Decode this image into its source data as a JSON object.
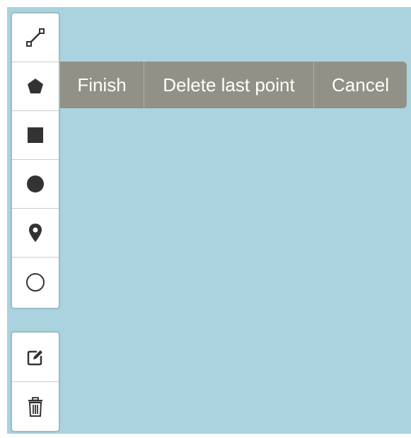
{
  "colors": {
    "map_background": "#aad3df",
    "toolbar_background": "#ffffff",
    "action_bar_background": "#919187",
    "icon_color": "#333333"
  },
  "draw_toolbar": {
    "tools": [
      {
        "name": "polyline",
        "icon": "polyline-icon"
      },
      {
        "name": "polygon",
        "icon": "polygon-icon"
      },
      {
        "name": "rectangle",
        "icon": "rectangle-icon"
      },
      {
        "name": "circle",
        "icon": "filled-circle-icon"
      },
      {
        "name": "marker",
        "icon": "map-marker-icon"
      },
      {
        "name": "circlemarker",
        "icon": "circle-marker-icon"
      }
    ]
  },
  "edit_toolbar": {
    "tools": [
      {
        "name": "edit",
        "icon": "edit-icon"
      },
      {
        "name": "delete",
        "icon": "trash-icon"
      }
    ]
  },
  "actions": {
    "finish_label": "Finish",
    "delete_last_point_label": "Delete last point",
    "cancel_label": "Cancel"
  }
}
